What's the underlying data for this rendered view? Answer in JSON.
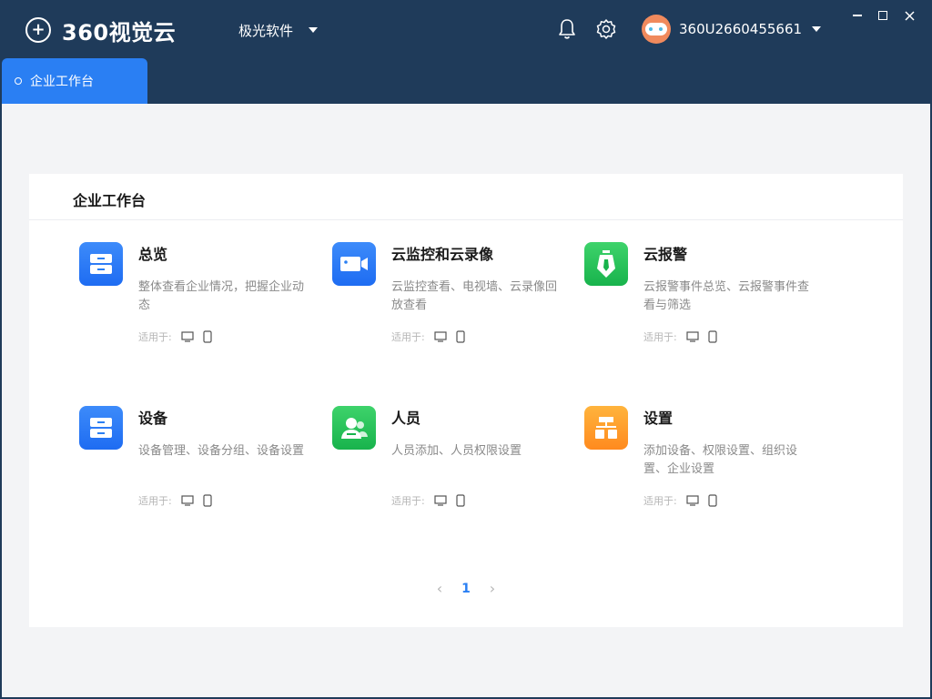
{
  "app": {
    "logo_mark": "+",
    "logo_text": "360视觉云",
    "org_name": "极光软件",
    "user_name": "360U2660455661"
  },
  "tabs": [
    {
      "label": "企业工作台",
      "active": true
    }
  ],
  "panel": {
    "title": "企业工作台",
    "apply_label": "适用于:"
  },
  "cards": [
    {
      "title": "总览",
      "desc": "整体查看企业情况，把握企业动态",
      "icon": "cabinet-icon"
    },
    {
      "title": "云监控和云录像",
      "desc": "云监控查看、电视墙、云录像回放查看",
      "icon": "camera-icon"
    },
    {
      "title": "云报警",
      "desc": "云报警事件总览、云报警事件查看与筛选",
      "icon": "alarm-icon"
    },
    {
      "title": "设备",
      "desc": "设备管理、设备分组、设备设置",
      "icon": "cabinet-icon"
    },
    {
      "title": "人员",
      "desc": "人员添加、人员权限设置",
      "icon": "users-icon"
    },
    {
      "title": "设置",
      "desc": "添加设备、权限设置、组织设置、企业设置",
      "icon": "org-chart-icon"
    }
  ],
  "pager": {
    "prev": "‹",
    "current": "1",
    "next": "›"
  },
  "colors": {
    "header_bg": "#1f3b5a",
    "accent": "#2a7ff3",
    "content_bg": "#f3f4f6"
  }
}
